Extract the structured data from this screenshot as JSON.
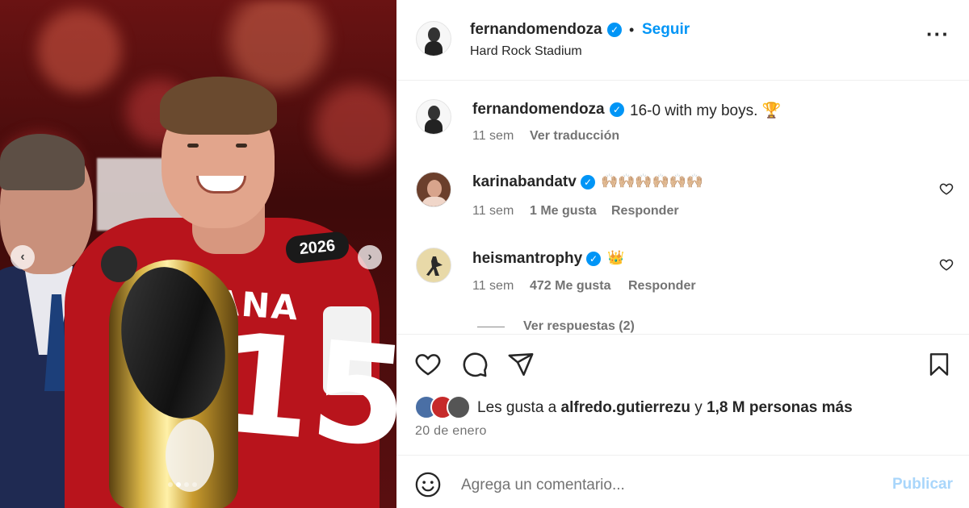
{
  "post": {
    "author": "fernandomendoza",
    "follow_label": "Seguir",
    "separator": "•",
    "location": "Hard Rock Stadium",
    "more_icon": "more-horizontal-icon",
    "carousel": {
      "slide_count": 4,
      "active_index": 1
    },
    "jersey": {
      "word": "DIANA",
      "number": "15",
      "patch": "2026"
    }
  },
  "caption": {
    "author": "fernandomendoza",
    "text": "16-0 with my boys. 🏆",
    "age": "11 sem",
    "translate_label": "Ver traducción"
  },
  "comments": [
    {
      "author": "karinabandatv",
      "text": "🙌🏼🙌🏼🙌🏼🙌🏼🙌🏼🙌🏼",
      "age": "11 sem",
      "likes": "1 Me gusta",
      "reply_label": "Responder"
    },
    {
      "author": "heismantrophy",
      "text": "👑",
      "age": "11 sem",
      "likes": "472 Me gusta",
      "reply_label": "Responder",
      "view_replies": "Ver respuestas (2)"
    }
  ],
  "actions": {
    "like_icon": "heart-icon",
    "comment_icon": "comment-icon",
    "share_icon": "share-icon",
    "save_icon": "bookmark-icon"
  },
  "likes_summary": {
    "prefix": "Les gusta a",
    "user": "alfredo.gutierrezu",
    "conj": "y",
    "others": "1,8 M personas más"
  },
  "date": "20 de enero",
  "composer": {
    "placeholder": "Agrega un comentario...",
    "publish_label": "Publicar"
  },
  "colors": {
    "accent": "#0095f6",
    "publish_disabled": "#a9d6fb",
    "text": "#262626",
    "muted": "#737373",
    "jersey_red": "#b8141c"
  }
}
